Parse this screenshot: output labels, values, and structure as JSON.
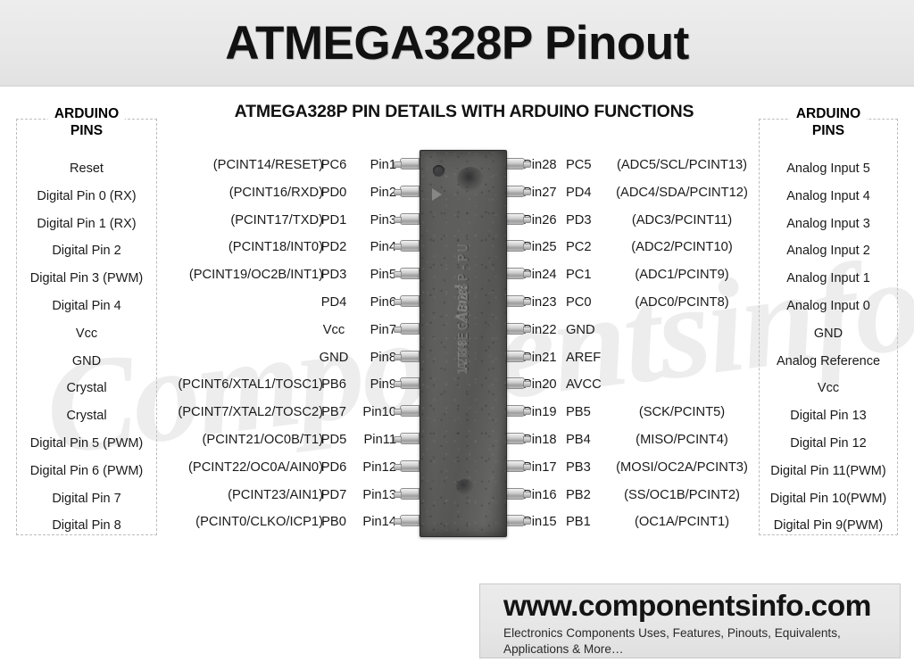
{
  "header": {
    "title": "ATMEGA328P Pinout"
  },
  "subtitle": "ATMEGA328P PIN DETAILS WITH ARDUINO FUNCTIONS",
  "watermark": "Componentsinfo.Com",
  "arduino_left": {
    "legend_line1": "ARDUINO",
    "legend_line2": "PINS",
    "items": [
      "Reset",
      "Digital Pin 0 (RX)",
      "Digital Pin 1 (RX)",
      "Digital Pin 2",
      "Digital Pin 3 (PWM)",
      "Digital Pin 4",
      "Vcc",
      "GND",
      "Crystal",
      "Crystal",
      "Digital Pin 5 (PWM)",
      "Digital Pin 6 (PWM)",
      "Digital Pin 7",
      "Digital Pin 8"
    ]
  },
  "arduino_right": {
    "legend_line1": "ARDUINO",
    "legend_line2": "PINS",
    "items": [
      "Analog Input 5",
      "Analog Input 4",
      "Analog Input 3",
      "Analog Input 2",
      "Analog Input 1",
      "Analog Input 0",
      "GND",
      "Analog Reference",
      "Vcc",
      "Digital Pin 13",
      "Digital Pin 12",
      "Digital Pin 11(PWM)",
      "Digital Pin 10(PWM)",
      "Digital Pin 9(PWM)"
    ]
  },
  "left_pins": [
    {
      "func": "(PCINT14/RESET)",
      "port": "PC6",
      "pin": "Pin1"
    },
    {
      "func": "(PCINT16/RXD)",
      "port": "PD0",
      "pin": "Pin2"
    },
    {
      "func": "(PCINT17/TXD)",
      "port": "PD1",
      "pin": "Pin3"
    },
    {
      "func": "(PCINT18/INT0)",
      "port": "PD2",
      "pin": "Pin4"
    },
    {
      "func": "(PCINT19/OC2B/INT1)",
      "port": "PD3",
      "pin": "Pin5"
    },
    {
      "func": "",
      "port": "PD4",
      "pin": "Pin6"
    },
    {
      "func": "",
      "port": "Vcc",
      "pin": "Pin7"
    },
    {
      "func": "",
      "port": "GND",
      "pin": "Pin8"
    },
    {
      "func": "(PCINT6/XTAL1/TOSC1)",
      "port": "PB6",
      "pin": "Pin9"
    },
    {
      "func": "(PCINT7/XTAL2/TOSC2)",
      "port": "PB7",
      "pin": "Pin10"
    },
    {
      "func": "(PCINT21/OC0B/T1)",
      "port": "PD5",
      "pin": "Pin11"
    },
    {
      "func": "(PCINT22/OC0A/AIN0)",
      "port": "PD6",
      "pin": "Pin12"
    },
    {
      "func": "(PCINT23/AIN1)",
      "port": "PD7",
      "pin": "Pin13"
    },
    {
      "func": "(PCINT0/CLKO/ICP1)",
      "port": "PB0",
      "pin": "Pin14"
    }
  ],
  "right_pins": [
    {
      "pin": "Pin28",
      "port": "PC5",
      "func": "(ADC5/SCL/PCINT13)"
    },
    {
      "pin": "Pin27",
      "port": "PD4",
      "func": "(ADC4/SDA/PCINT12)"
    },
    {
      "pin": "Pin26",
      "port": "PD3",
      "func": "(ADC3/PCINT11)"
    },
    {
      "pin": "Pin25",
      "port": "PC2",
      "func": "(ADC2/PCINT10)"
    },
    {
      "pin": "Pin24",
      "port": "PC1",
      "func": "(ADC1/PCINT9)"
    },
    {
      "pin": "Pin23",
      "port": "PC0",
      "func": "(ADC0/PCINT8)"
    },
    {
      "pin": "Pin22",
      "port": "GND",
      "func": ""
    },
    {
      "pin": "Pin21",
      "port": "AREF",
      "func": ""
    },
    {
      "pin": "Pin20",
      "port": "AVCC",
      "func": ""
    },
    {
      "pin": "Pin19",
      "port": "PB5",
      "func": "(SCK/PCINT5)"
    },
    {
      "pin": "Pin18",
      "port": "PB4",
      "func": "(MISO/PCINT4)"
    },
    {
      "pin": "Pin17",
      "port": "PB3",
      "func": "(MOSI/OC2A/PCINT3)"
    },
    {
      "pin": "Pin16",
      "port": "PB2",
      "func": "(SS/OC1B/PCINT2)"
    },
    {
      "pin": "Pin15",
      "port": "PB1",
      "func": "(OC1A/PCINT1)"
    }
  ],
  "chip": {
    "marking_line1": "ATMEGA328P-PU",
    "marking_line2": "1288",
    "logo_text": "Atmel",
    "pin_count": 28,
    "pins_per_side": 14
  },
  "footer": {
    "url": "www.componentsinfo.com",
    "tagline": "Electronics Components Uses, Features, Pinouts, Equivalents, Applications & More…"
  },
  "colors": {
    "page_background": "#ffffff",
    "header_background": "#e9e9e9",
    "chip_body": "#5c5c5a",
    "chip_lead": "#cfcfcf",
    "text": "#1a1a1a",
    "watermark": "#ededed",
    "dashed_border": "#bdbdbd"
  }
}
